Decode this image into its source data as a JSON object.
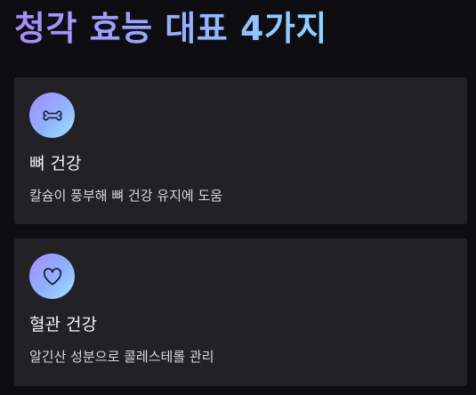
{
  "page": {
    "title": "청각 효능 대표 4가지"
  },
  "cards": [
    {
      "icon": "bone-icon",
      "title": "뼈 건강",
      "description": "칼슘이 풍부해 뼈 건강 유지에 도움"
    },
    {
      "icon": "heart-icon",
      "title": "혈관 건강",
      "description": "알긴산 성분으로 콜레스테롤 관리"
    }
  ],
  "colors": {
    "background": "#0e0d12",
    "card": "#222126",
    "gradient_start": "#a78bfa",
    "gradient_end": "#8fd6ff"
  }
}
